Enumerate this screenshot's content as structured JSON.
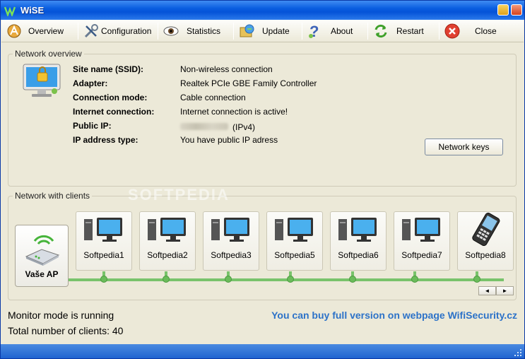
{
  "window": {
    "title": "WiSE"
  },
  "toolbar": [
    {
      "label": "Overview",
      "icon": "overview-icon"
    },
    {
      "label": "Configuration",
      "icon": "tools-icon"
    },
    {
      "label": "Statistics",
      "icon": "eye-icon"
    },
    {
      "label": "Update",
      "icon": "update-icon"
    },
    {
      "label": "About",
      "icon": "help-icon"
    },
    {
      "label": "Restart",
      "icon": "restart-icon"
    },
    {
      "label": "Close",
      "icon": "close-icon"
    }
  ],
  "overview": {
    "legend": "Network overview",
    "rows": [
      {
        "label": "Site name (SSID):",
        "value": "Non-wireless connection"
      },
      {
        "label": "Adapter:",
        "value": "Realtek PCIe GBE Family Controller"
      },
      {
        "label": "Connection mode:",
        "value": "Cable connection"
      },
      {
        "label": "Internet connection:",
        "value": "Internet connection is active!"
      },
      {
        "label": "Public IP:",
        "value": "(IPv4)"
      },
      {
        "label": "IP address type:",
        "value": "You have public IP adress"
      }
    ],
    "network_keys": "Network keys"
  },
  "clients": {
    "legend": "Network with clients",
    "watermark": "SOFTPEDIA",
    "ap_label": "Vaše AP",
    "items": [
      "Softpedia1",
      "Softpedia2",
      "Softpedia3",
      "Softpedia5",
      "Softpedia6",
      "Softpedia7",
      "Softpedia8"
    ],
    "scroll_left": "◄",
    "scroll_right": "►"
  },
  "status": {
    "monitor": "Monitor mode is running",
    "total": "Total number of clients: 40",
    "buy": "You can buy full version on webpage WifiSecurity.cz"
  },
  "colors": {
    "link": "#2c72c8",
    "bus": "#79c36b",
    "titlebar": "#0553d8"
  }
}
